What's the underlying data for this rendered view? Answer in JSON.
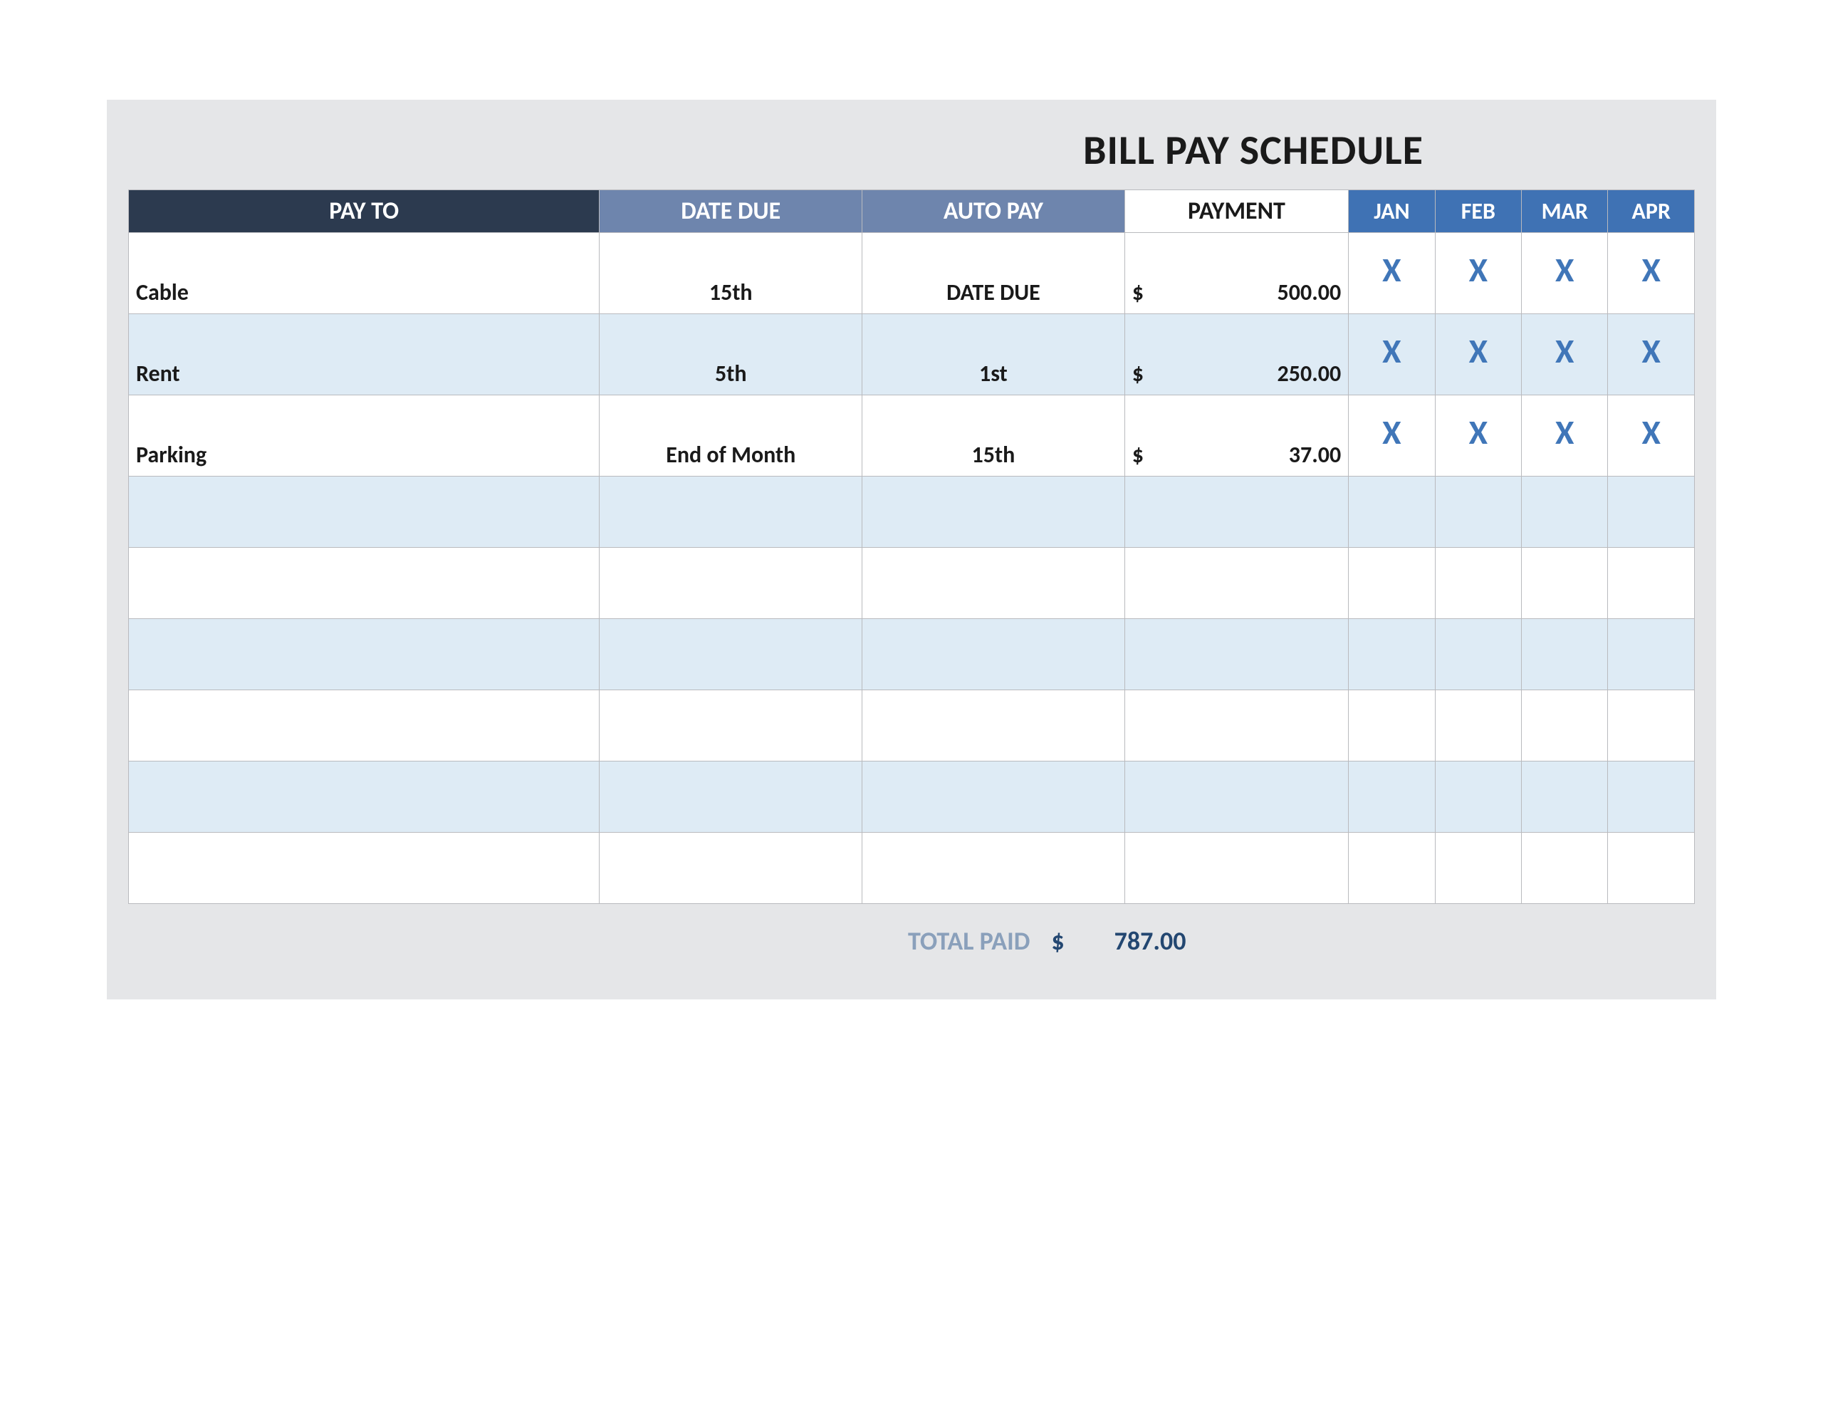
{
  "title": "BILL PAY SCHEDULE",
  "headers": {
    "pay_to": "PAY TO",
    "date_due": "DATE DUE",
    "auto_pay": "AUTO PAY",
    "payment": "PAYMENT",
    "months": [
      "JAN",
      "FEB",
      "MAR",
      "APR"
    ]
  },
  "rows": [
    {
      "pay_to": "Cable",
      "date_due": "15th",
      "auto_pay": "DATE DUE",
      "currency": "$",
      "payment": "500.00",
      "months": [
        "X",
        "X",
        "X",
        "X"
      ]
    },
    {
      "pay_to": "Rent",
      "date_due": "5th",
      "auto_pay": "1st",
      "currency": "$",
      "payment": "250.00",
      "months": [
        "X",
        "X",
        "X",
        "X"
      ]
    },
    {
      "pay_to": "Parking",
      "date_due": "End of Month",
      "auto_pay": "15th",
      "currency": "$",
      "payment": "37.00",
      "months": [
        "X",
        "X",
        "X",
        "X"
      ]
    },
    {
      "pay_to": "",
      "date_due": "",
      "auto_pay": "",
      "currency": "",
      "payment": "",
      "months": [
        "",
        "",
        "",
        ""
      ]
    },
    {
      "pay_to": "",
      "date_due": "",
      "auto_pay": "",
      "currency": "",
      "payment": "",
      "months": [
        "",
        "",
        "",
        ""
      ]
    },
    {
      "pay_to": "",
      "date_due": "",
      "auto_pay": "",
      "currency": "",
      "payment": "",
      "months": [
        "",
        "",
        "",
        ""
      ]
    },
    {
      "pay_to": "",
      "date_due": "",
      "auto_pay": "",
      "currency": "",
      "payment": "",
      "months": [
        "",
        "",
        "",
        ""
      ]
    },
    {
      "pay_to": "",
      "date_due": "",
      "auto_pay": "",
      "currency": "",
      "payment": "",
      "months": [
        "",
        "",
        "",
        ""
      ]
    },
    {
      "pay_to": "",
      "date_due": "",
      "auto_pay": "",
      "currency": "",
      "payment": "",
      "months": [
        "",
        "",
        "",
        ""
      ]
    }
  ],
  "total": {
    "label": "TOTAL PAID",
    "currency": "$",
    "value": "787.00"
  }
}
